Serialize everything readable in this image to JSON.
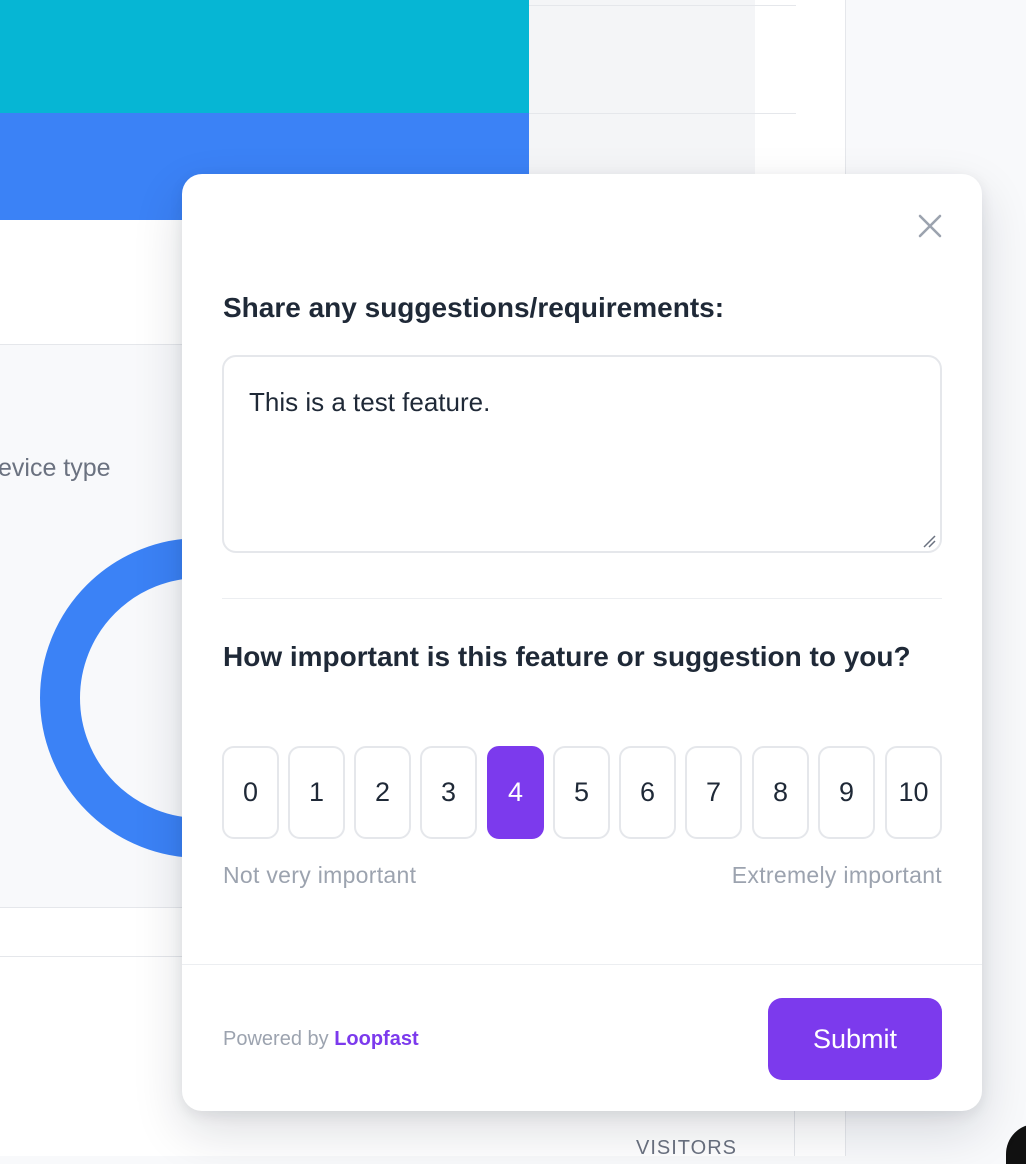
{
  "background": {
    "device_type_label": "evice type",
    "visitors_label": "VISITORS",
    "colors": {
      "cyan_bar": "#06b6d4",
      "blue_bar": "#3b82f6"
    }
  },
  "modal": {
    "close_icon": "close-icon",
    "suggestions": {
      "question": "Share any suggestions/requirements:",
      "value": "This is a test feature."
    },
    "importance": {
      "question": "How important is this feature or suggestion to you?",
      "options": [
        "0",
        "1",
        "2",
        "3",
        "4",
        "5",
        "6",
        "7",
        "8",
        "9",
        "10"
      ],
      "selected": "4",
      "low_label": "Not very important",
      "high_label": "Extremely important"
    },
    "footer": {
      "powered_by": "Powered by",
      "brand": "Loopfast",
      "submit_label": "Submit"
    },
    "colors": {
      "accent": "#7c3aed"
    }
  }
}
